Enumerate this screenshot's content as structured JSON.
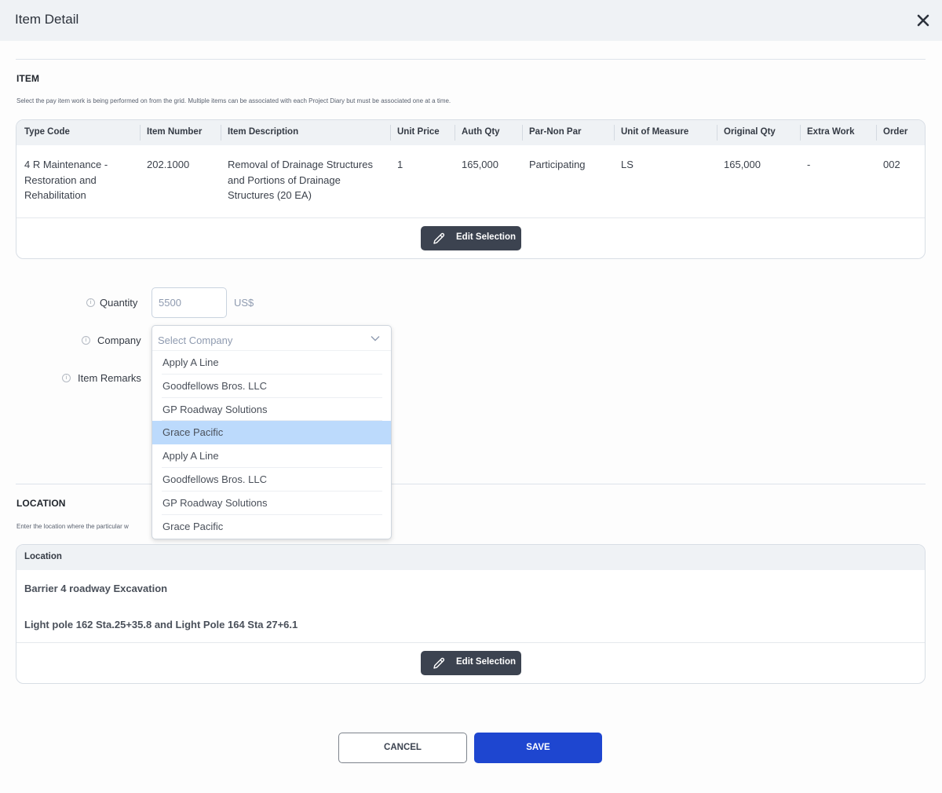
{
  "header": {
    "title": "Item Detail",
    "close_icon": "close-icon"
  },
  "item_section": {
    "title": "ITEM",
    "description": "Select the pay item work is being performed on from the grid. Multiple items can be associated with each Project Diary but must be associated one at a time.",
    "columns": [
      "Type Code",
      "Item Number",
      "Item Description",
      "Unit Price",
      "Auth Qty",
      "Par-Non Par",
      "Unit of Measure",
      "Original Qty",
      "Extra Work",
      "Order"
    ],
    "row": {
      "type_code": "4 R Maintenance - Restoration and Rehabilitation",
      "item_number": "202.1000",
      "item_description": "Removal of Drainage Structures and Portions of Drainage Structures (20 EA)",
      "unit_price": "1",
      "auth_qty": "165,000",
      "par_non_par": "Participating",
      "unit_of_measure": "LS",
      "original_qty": "165,000",
      "extra_work": "-",
      "order": "002"
    },
    "edit_button": "Edit Selection"
  },
  "form": {
    "quantity_label": "Quantity",
    "quantity_value": "5500",
    "currency": "US$",
    "company_label": "Company",
    "company_placeholder": "Select Company",
    "item_remarks_label": "Item Remarks",
    "info_icon_glyph": "i",
    "company_options": [
      {
        "label": "Apply A Line",
        "selected": false
      },
      {
        "label": "Goodfellows Bros. LLC",
        "selected": false
      },
      {
        "label": "GP Roadway Solutions",
        "selected": false
      },
      {
        "label": "Grace Pacific",
        "selected": true
      },
      {
        "label": "Apply A Line",
        "selected": false
      },
      {
        "label": "Goodfellows Bros. LLC",
        "selected": false
      },
      {
        "label": "GP Roadway Solutions",
        "selected": false
      },
      {
        "label": "Grace Pacific",
        "selected": false
      }
    ]
  },
  "location_section": {
    "title": "LOCATION",
    "description_visible": "Enter the location where the particular w",
    "column": "Location",
    "rows": [
      "Barrier 4 roadway Excavation",
      "Light pole 162 Sta.25+35.8 and Light Pole 164 Sta 27+6.1"
    ],
    "edit_button": "Edit Selection"
  },
  "footer": {
    "cancel": "CANCEL",
    "save": "SAVE"
  },
  "colors": {
    "primary": "#1e46d0",
    "dark_button": "#3c4350",
    "selected_option": "#bcdafc",
    "header_bg": "#eff2f5"
  }
}
